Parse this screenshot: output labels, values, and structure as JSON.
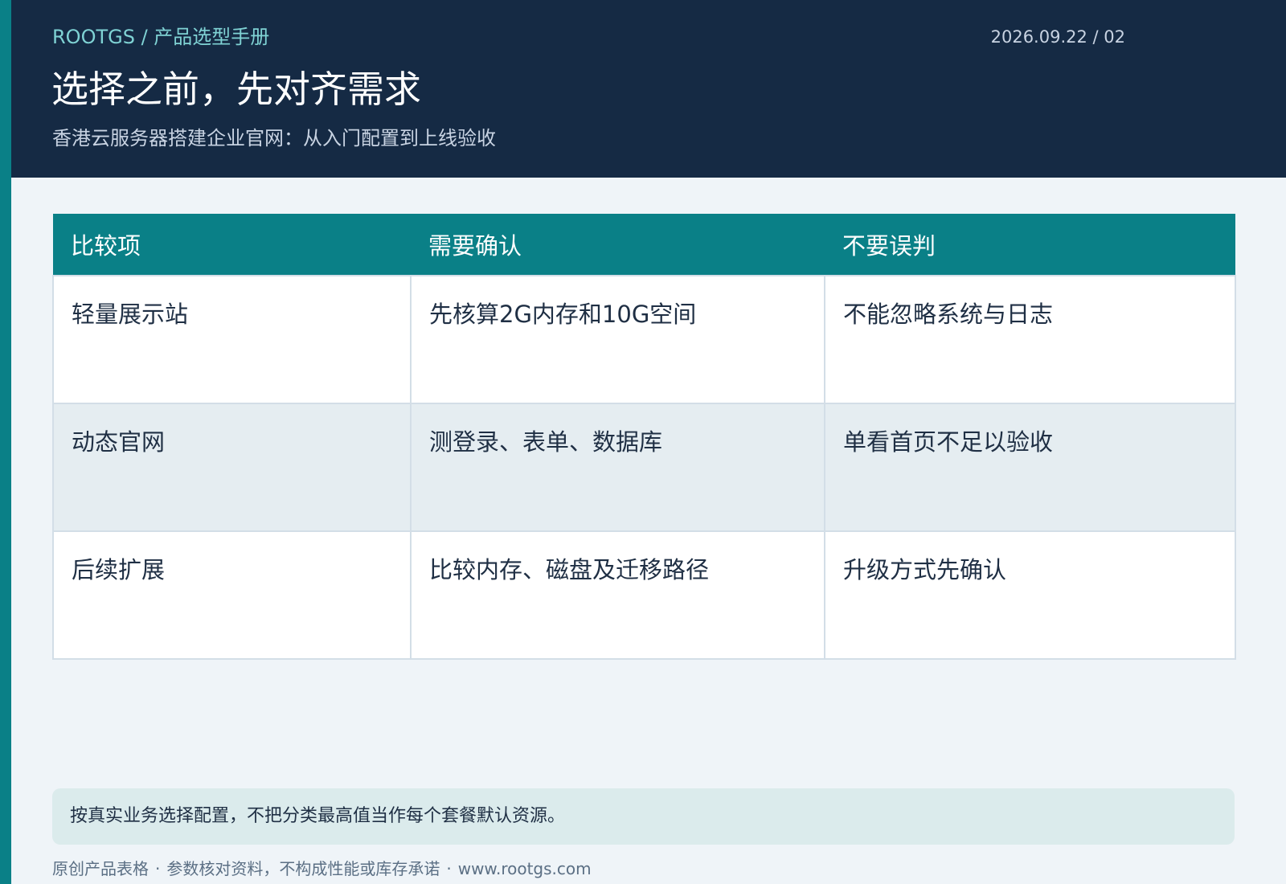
{
  "header": {
    "breadcrumb": "ROOTGS / 产品选型手册",
    "date_page": "2026.09.22 / 02",
    "title": "选择之前，先对齐需求",
    "subtitle": "香港云服务器搭建企业官网：从入门配置到上线验收"
  },
  "table": {
    "headers": [
      "比较项",
      "需要确认",
      "不要误判"
    ],
    "rows": [
      [
        "轻量展示站",
        "先核算2G内存和10G空间",
        "不能忽略系统与日志"
      ],
      [
        "动态官网",
        "测登录、表单、数据库",
        "单看首页不足以验收"
      ],
      [
        "后续扩展",
        "比较内存、磁盘及迁移路径",
        "升级方式先确认"
      ]
    ]
  },
  "note": "按真实业务选择配置，不把分类最高值当作每个套餐默认资源。",
  "footer": {
    "items": [
      "原创产品表格",
      "参数核对资料，不构成性能或库存承诺",
      "www.rootgs.com"
    ],
    "separator": "·"
  },
  "colors": {
    "accent": "#0a8087",
    "header_bg": "#152a44",
    "page_bg": "#eff4f8",
    "note_bg": "#dbebec"
  }
}
